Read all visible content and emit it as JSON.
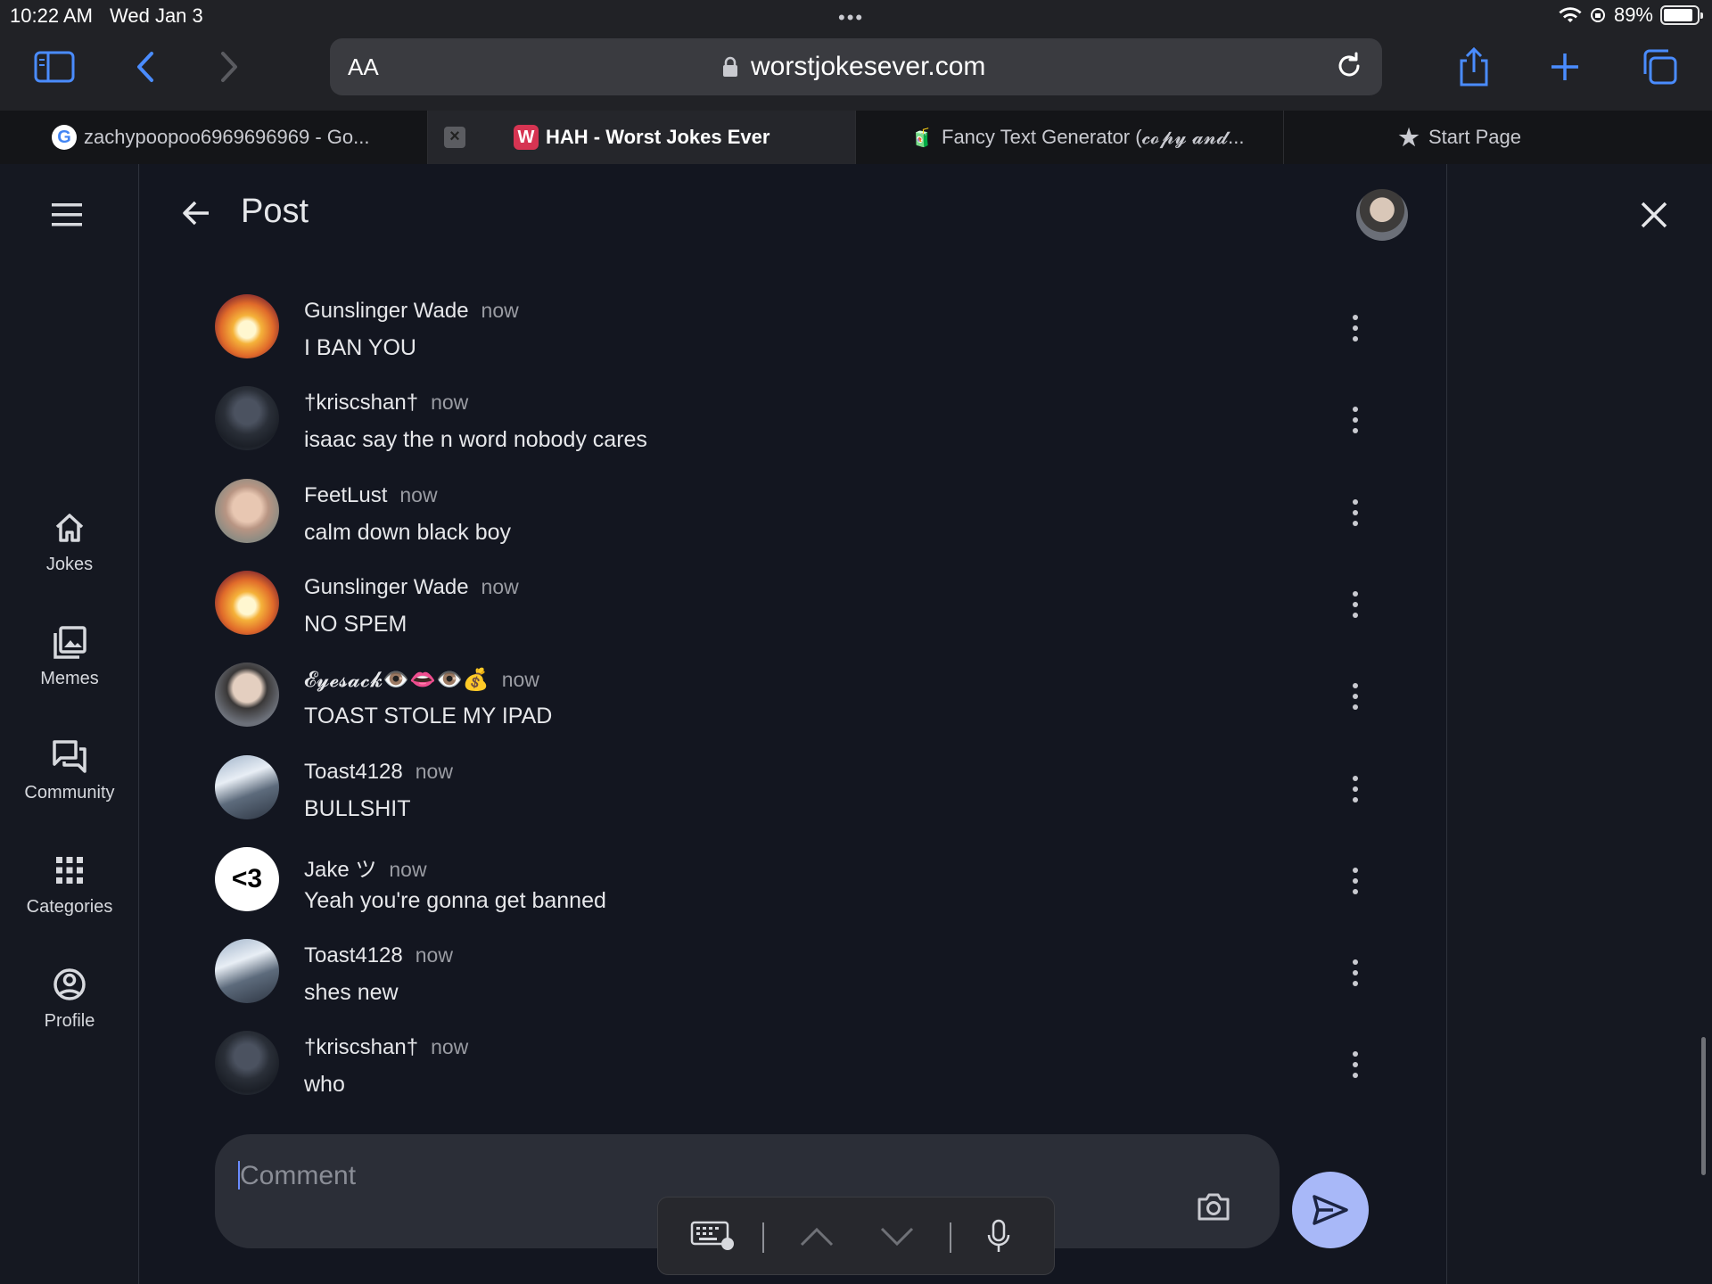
{
  "status": {
    "time": "10:22 AM",
    "date": "Wed Jan 3",
    "battery": "89%",
    "battery_level": 0.89
  },
  "safari": {
    "text_size_label": "AA",
    "url": "worstjokesever.com"
  },
  "tabs": [
    {
      "title": "zachypoopoo6969696969 - Go...",
      "favicon": "G"
    },
    {
      "title": "HAH - Worst Jokes Ever",
      "favicon": "W"
    },
    {
      "title": "Fancy Text Generator (𝓬𝓸𝓹𝔂 𝓪𝓷𝓭...",
      "favicon": "🧃"
    },
    {
      "title": "Start Page",
      "favicon": "★"
    }
  ],
  "nav": [
    {
      "label": "Jokes",
      "icon": "home-icon"
    },
    {
      "label": "Memes",
      "icon": "gallery-icon"
    },
    {
      "label": "Community",
      "icon": "forum-icon"
    },
    {
      "label": "Categories",
      "icon": "grid-icon"
    },
    {
      "label": "Profile",
      "icon": "account-icon"
    }
  ],
  "post": {
    "title": "Post"
  },
  "comments": [
    {
      "name": "Gunslinger Wade",
      "time": "now",
      "text": "I BAN YOU",
      "avatar": "fire"
    },
    {
      "name": "†kriscshan†",
      "time": "now",
      "text": "isaac say the n word nobody cares",
      "avatar": "robot"
    },
    {
      "name": "FeetLust",
      "time": "now",
      "text": "calm down black boy",
      "avatar": "face"
    },
    {
      "name": "Gunslinger Wade",
      "time": "now",
      "text": "NO SPEM",
      "avatar": "fire"
    },
    {
      "name": "𝓔𝔂𝓮𝓼𝓪𝓬𝓴👁️👄👁️💰",
      "time": "now",
      "text": "TOAST STOLE MY IPAD",
      "avatar": "eyesack"
    },
    {
      "name": "Toast4128",
      "time": "now",
      "text": "BULLSHIT",
      "avatar": "toast"
    },
    {
      "name": "Jake ツ",
      "time": "now",
      "text": "Yeah you're gonna get banned",
      "avatar": "jake",
      "avatar_text": "<3"
    },
    {
      "name": "Toast4128",
      "time": "now",
      "text": "shes new",
      "avatar": "toast"
    },
    {
      "name": "†kriscshan†",
      "time": "now",
      "text": "who",
      "avatar": "robot"
    }
  ],
  "comment_box": {
    "placeholder": "Comment",
    "value": ""
  },
  "colors": {
    "accent": "#a8b8f8",
    "background": "#131620",
    "chrome": "#212226"
  }
}
